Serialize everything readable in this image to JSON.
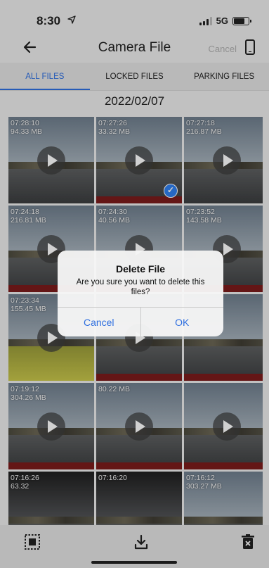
{
  "status": {
    "time": "8:30",
    "network": "5G"
  },
  "nav": {
    "title": "Camera File",
    "cancel_label": "Cancel"
  },
  "tabs": [
    {
      "label": "ALL FILES",
      "active": true
    },
    {
      "label": "LOCKED FILES",
      "active": false
    },
    {
      "label": "PARKING FILES",
      "active": false
    }
  ],
  "date_header": "2022/02/07",
  "files": [
    {
      "time": "07:28:10",
      "size": "94.33 MB",
      "selected": false
    },
    {
      "time": "07:27:26",
      "size": "33.32 MB",
      "selected": true
    },
    {
      "time": "07:27:18",
      "size": "216.87 MB",
      "selected": false
    },
    {
      "time": "07:24:18",
      "size": "216.81 MB",
      "selected": false
    },
    {
      "time": "07:24:30",
      "size": "40.56 MB",
      "selected": false
    },
    {
      "time": "07:23:52",
      "size": "143.58 MB",
      "selected": false
    },
    {
      "time": "07:23:34",
      "size": "155.45 MB",
      "selected": false
    },
    {
      "time": "",
      "size": "",
      "selected": false
    },
    {
      "time": "",
      "size": "",
      "selected": false
    },
    {
      "time": "07:19:12",
      "size": "304.26 MB",
      "selected": false
    },
    {
      "time": "",
      "size": "80.22 MB",
      "selected": false
    },
    {
      "time": "",
      "size": "",
      "selected": false
    },
    {
      "time": "07:16:26",
      "size": "63.32",
      "selected": false
    },
    {
      "time": "07:16:20",
      "size": "",
      "selected": false
    },
    {
      "time": "07:16:12",
      "size": "303.27 MB",
      "selected": false
    }
  ],
  "dialog": {
    "title": "Delete File",
    "message": "Are you sure you want to delete this files?",
    "cancel_label": "Cancel",
    "ok_label": "OK"
  },
  "colors": {
    "accent": "#2f6fe0",
    "selected_check": "#2f7ff0"
  },
  "icons": [
    "back-arrow-icon",
    "phone-icon",
    "play-icon",
    "checkmark-icon",
    "select-all-icon",
    "download-icon",
    "trash-icon"
  ]
}
